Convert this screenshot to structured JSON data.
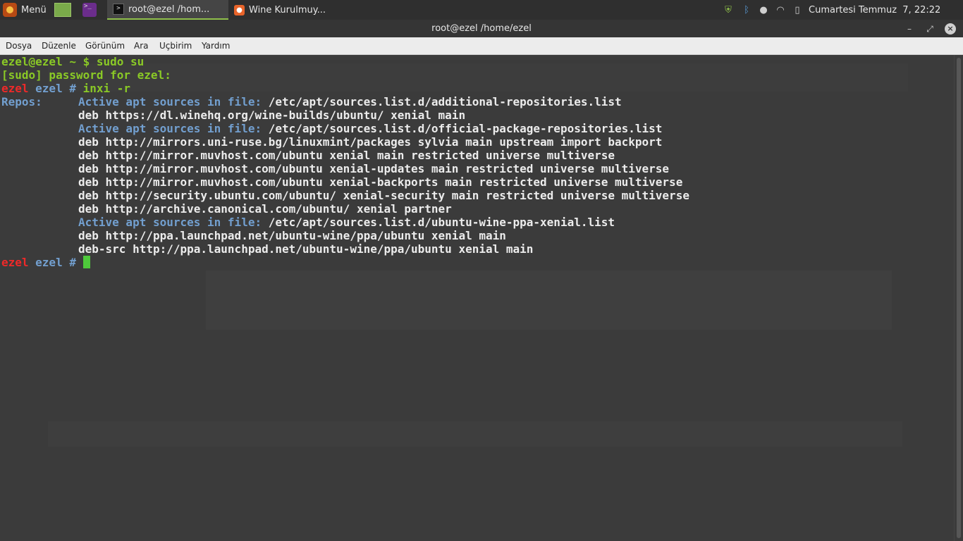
{
  "panel": {
    "menu_label": "Menü",
    "tasks": [
      {
        "label": "root@ezel /hom...",
        "active": true
      },
      {
        "label": "Wine Kurulmuy...",
        "active": false
      }
    ],
    "clock": "Cumartesi Temmuz  7, 22:22"
  },
  "window": {
    "title": "root@ezel /home/ezel"
  },
  "menubar": [
    "Dosya",
    "Düzenle",
    "Görünüm",
    "Ara",
    "Uçbirim",
    "Yardım"
  ],
  "terminal": {
    "l1": {
      "prompt": "ezel@ezel ~ $",
      "cmd": " sudo su"
    },
    "l2": {
      "text": "[sudo] password for ezel:"
    },
    "l3": {
      "user": "ezel",
      "host": " ezel #",
      "cmd": " inxi -r"
    },
    "repos_label": "Repos:",
    "block1": {
      "label": "Active apt sources in file:",
      "file": " /etc/apt/sources.list.d/additional-repositories.list"
    },
    "b1_lines": [
      "deb https://dl.winehq.org/wine-builds/ubuntu/ xenial main"
    ],
    "block2": {
      "label": "Active apt sources in file:",
      "file": " /etc/apt/sources.list.d/official-package-repositories.list"
    },
    "b2_lines": [
      "deb http://mirrors.uni-ruse.bg/linuxmint/packages sylvia main upstream import backport",
      "deb http://mirror.muvhost.com/ubuntu xenial main restricted universe multiverse",
      "deb http://mirror.muvhost.com/ubuntu xenial-updates main restricted universe multiverse",
      "deb http://mirror.muvhost.com/ubuntu xenial-backports main restricted universe multiverse",
      "deb http://security.ubuntu.com/ubuntu/ xenial-security main restricted universe multiverse",
      "deb http://archive.canonical.com/ubuntu/ xenial partner"
    ],
    "block3": {
      "label": "Active apt sources in file:",
      "file": " /etc/apt/sources.list.d/ubuntu-wine-ppa-xenial.list"
    },
    "b3_lines": [
      "deb http://ppa.launchpad.net/ubuntu-wine/ppa/ubuntu xenial main",
      "deb-src http://ppa.launchpad.net/ubuntu-wine/ppa/ubuntu xenial main"
    ],
    "last": {
      "user": "ezel",
      "host": " ezel #"
    }
  },
  "colors": {
    "prompt_green": "#8ac926",
    "root_red": "#ef2929",
    "label_blue": "#729fcf",
    "cursor": "#4ec93b"
  },
  "icons": [
    "mint-menu-icon",
    "files-icon",
    "terminal-launcher-icon",
    "shield-icon",
    "bluetooth-icon",
    "user-icon",
    "wifi-icon",
    "battery-icon"
  ]
}
